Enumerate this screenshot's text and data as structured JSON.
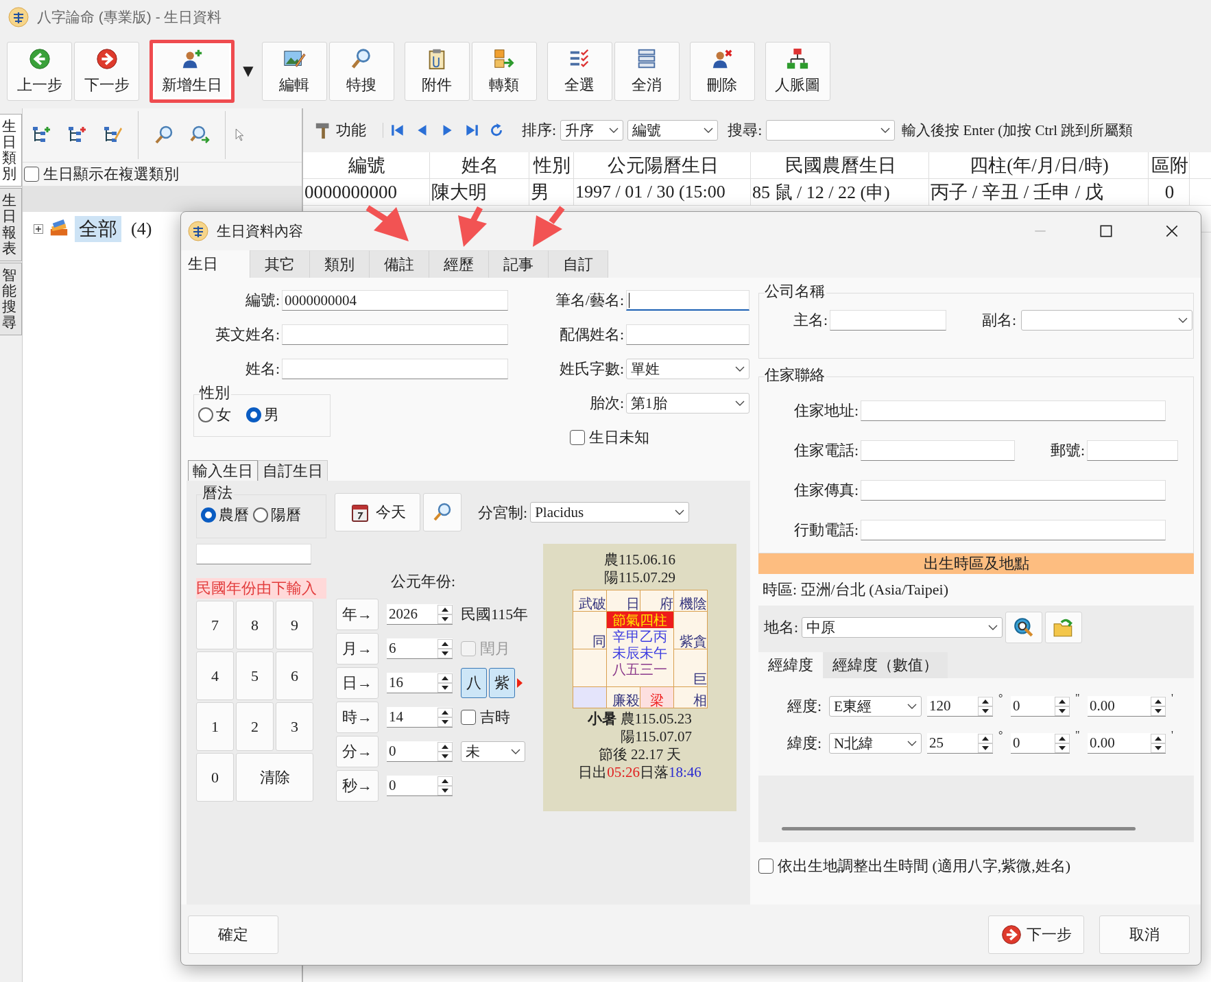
{
  "window": {
    "title": "八字論命 (專業版) - 生日資料"
  },
  "toolbar": [
    {
      "kind": "back",
      "label": "上一步",
      "highlighted": false
    },
    {
      "kind": "forward",
      "label": "下一步",
      "highlighted": false
    },
    {
      "kind": "add",
      "label": "新增生日",
      "highlighted": true
    },
    {
      "kind": "dropdown",
      "label": "▼",
      "highlighted": false
    },
    {
      "kind": "edit",
      "label": "編輯",
      "highlighted": false
    },
    {
      "kind": "search",
      "label": "特搜",
      "highlighted": false
    },
    {
      "kind": "attach",
      "label": "附件",
      "highlighted": false
    },
    {
      "kind": "move",
      "label": "轉類",
      "highlighted": false
    },
    {
      "kind": "selectall",
      "label": "全選",
      "highlighted": false
    },
    {
      "kind": "clearall",
      "label": "全消",
      "highlighted": false
    },
    {
      "kind": "delete",
      "label": "刪除",
      "highlighted": false
    },
    {
      "kind": "network",
      "label": "人脈圖",
      "highlighted": false
    }
  ],
  "side_tabs": [
    {
      "label": "生日類別",
      "selected": true
    },
    {
      "label": "生日報表",
      "selected": false
    },
    {
      "label": "智能搜尋",
      "selected": false
    }
  ],
  "category_panel": {
    "show_in_multi": {
      "label": "生日顯示在複選類別",
      "checked": false
    },
    "tree": [
      {
        "label": "全部",
        "count": "(4)",
        "expanded": false,
        "selected": true
      }
    ]
  },
  "list_toolbar": {
    "function_button": "功能",
    "sort_label": "排序:",
    "sort_order": "升序",
    "sort_field": "編號",
    "search_label": "搜尋:",
    "hint": "輸入後按 Enter (加按 Ctrl 跳到所屬類"
  },
  "table": {
    "columns": [
      "編號",
      "姓名",
      "性別",
      "公元陽曆生日",
      "民國農曆生日",
      "四柱(年/月/日/時)",
      "區附"
    ],
    "rows": [
      {
        "cells": [
          "0000000000",
          "陳大明",
          "男",
          "1997 / 01 / 30 (15:00",
          "85 鼠 / 12 / 22 (申)",
          "丙子 / 辛丑 / 壬申 / 戊",
          "0"
        ]
      }
    ]
  },
  "dialog": {
    "title": "生日資料內容",
    "tabs": [
      {
        "label": "生日",
        "selected": true
      },
      {
        "label": "其它",
        "selected": false
      },
      {
        "label": "類別",
        "selected": false
      },
      {
        "label": "備註",
        "selected": false
      },
      {
        "label": "經歷",
        "selected": false
      },
      {
        "label": "記事",
        "selected": false
      },
      {
        "label": "自訂",
        "selected": false
      }
    ],
    "form_left": [
      {
        "label": "編號:",
        "value": "0000000004"
      },
      {
        "label": "英文姓名:"
      },
      {
        "label": "姓名:"
      }
    ],
    "form_right": [
      {
        "label": "筆名/藝名:",
        "kind": "text",
        "focused": true
      },
      {
        "label": "配偶姓名:",
        "kind": "text",
        "focused": false
      },
      {
        "label": "姓氏字數:",
        "kind": "select",
        "value": "單姓",
        "focused": false
      },
      {
        "label": "胎次:",
        "kind": "select",
        "value": "第1胎",
        "focused": false
      }
    ],
    "gender": {
      "title": "性別",
      "options": [
        {
          "label": "女",
          "selected": false
        },
        {
          "label": "男",
          "selected": true
        }
      ]
    },
    "birthday_unknown": {
      "label": "生日未知",
      "checked": false
    },
    "input_tabs": [
      {
        "label": "輸入生日",
        "selected": true
      },
      {
        "label": "自訂生日",
        "selected": false
      }
    ],
    "calendar": {
      "title": "曆法",
      "options": [
        {
          "label": "農曆",
          "selected": true
        },
        {
          "label": "陽曆",
          "selected": false
        }
      ]
    },
    "today_button": "今天",
    "house_system": {
      "label": "分宮制:",
      "value": "Placidus"
    },
    "roc_hint": "民國年份由下輸入",
    "keypad": [
      {
        "label": "7",
        "kind": "digit"
      },
      {
        "label": "8",
        "kind": "digit"
      },
      {
        "label": "9",
        "kind": "digit"
      },
      {
        "label": "4",
        "kind": "digit"
      },
      {
        "label": "5",
        "kind": "digit"
      },
      {
        "label": "6",
        "kind": "digit"
      },
      {
        "label": "1",
        "kind": "digit"
      },
      {
        "label": "2",
        "kind": "digit"
      },
      {
        "label": "3",
        "kind": "digit"
      },
      {
        "label": "0",
        "kind": "digit"
      },
      {
        "label": "清除",
        "kind": "wide"
      }
    ],
    "ad_year_label": "公元年份:",
    "spinners": [
      {
        "button": "年→",
        "value": "2026"
      },
      {
        "button": "月→",
        "value": "6"
      },
      {
        "button": "日→",
        "value": "16"
      },
      {
        "button": "時→",
        "value": "14"
      },
      {
        "button": "分→",
        "value": "0"
      },
      {
        "button": "秒→",
        "value": "0"
      }
    ],
    "extras": [
      {
        "kind": "text",
        "text": "民國115年"
      },
      {
        "kind": "checkbox",
        "label": "閏月",
        "checked": false,
        "disabled": true
      },
      {
        "kind": "chartbuttons",
        "labels": [
          "八",
          "紫"
        ]
      },
      {
        "kind": "checkbox",
        "label": "吉時",
        "checked": false,
        "disabled": false
      },
      {
        "kind": "select",
        "value": "未"
      }
    ],
    "summary": {
      "lunar": "農115.06.16",
      "solar": "陽115.07.29",
      "palaces": [
        {
          "text": "武破",
          "kind": "plain"
        },
        {
          "text": "日",
          "kind": "plain"
        },
        {
          "text": "府",
          "kind": "plain"
        },
        {
          "text": "機陰",
          "kind": "plain"
        },
        {
          "text": "同",
          "kind": "plain"
        },
        {
          "text": "紫貪",
          "kind": "plain"
        },
        {
          "kind": "plain"
        },
        {
          "text": "巨",
          "kind": "plain"
        },
        {
          "kind": "shaded"
        },
        {
          "text": "廉殺",
          "kind": "plain"
        },
        {
          "text": "梁",
          "kind": "hot"
        },
        {
          "text": "相",
          "kind": "plain"
        }
      ],
      "pillars": {
        "title": "節氣四柱",
        "lines": [
          {
            "text": "辛甲乙丙",
            "kind": "stem"
          },
          {
            "text": "未辰未午",
            "kind": "stem"
          },
          {
            "text": "八五三一",
            "kind": "count"
          }
        ]
      },
      "term": "**小暑** 農115.05.23",
      "term_solar": "陽115.07.07",
      "after_term": "節後 22.17 天",
      "sunrise_label": "日出",
      "sunrise": "05:26",
      "sunset_label": "日落",
      "sunset": "18:46"
    },
    "ok_button": "確定",
    "next_button": "下一步",
    "cancel_button": "取消",
    "company": {
      "title": "公司名稱",
      "main_label": "主名:",
      "sub_label": "副名:"
    },
    "home": {
      "title": "住家聯絡",
      "rows": [
        {
          "fields": [
            {
              "label": "住家地址:",
              "kind": "wide"
            }
          ]
        },
        {
          "fields": [
            {
              "label": "住家電話:",
              "kind": "half"
            },
            {
              "label": "郵號:",
              "kind": "short"
            }
          ]
        },
        {
          "fields": [
            {
              "label": "住家傳真:",
              "kind": "wide"
            }
          ]
        },
        {
          "fields": [
            {
              "label": "行動電話:",
              "kind": "wide"
            }
          ]
        }
      ]
    },
    "birthplace": {
      "banner": "出生時區及地點",
      "timezone": "時區: 亞洲/台北 (Asia/Taipei)",
      "place_label": "地名:",
      "place_value": "中原",
      "coord_tabs": [
        {
          "label": "經緯度",
          "selected": true
        },
        {
          "label": "經緯度（數值）",
          "selected": false
        }
      ],
      "coords": [
        {
          "label": "經度:",
          "hemisphere": "E東經",
          "degrees": "120",
          "degree_mark": "°",
          "minutes": "0",
          "minute_mark": "\"",
          "seconds": "0.00",
          "second_mark": "'"
        },
        {
          "label": "緯度:",
          "hemisphere": "N北緯",
          "degrees": "25",
          "degree_mark": "°",
          "minutes": "0",
          "minute_mark": "\"",
          "seconds": "0.00",
          "second_mark": "'"
        }
      ]
    },
    "adjust_time": {
      "label": "依出生地調整出生時間 (適用八字,紫微,姓名)",
      "checked": false
    }
  }
}
